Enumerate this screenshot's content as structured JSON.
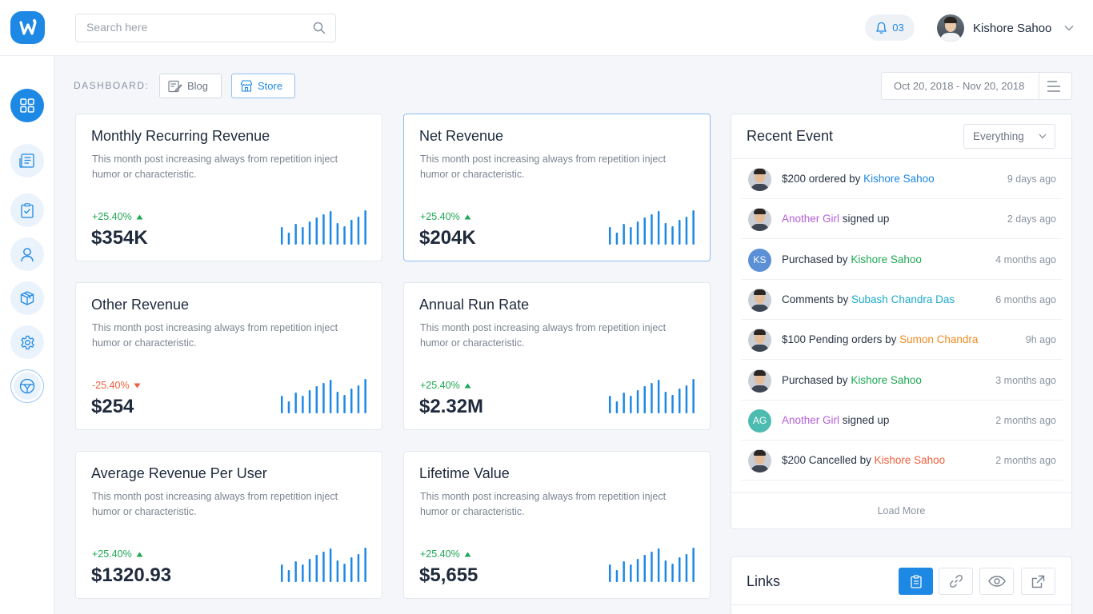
{
  "app": {
    "logo_letter": "w"
  },
  "search": {
    "placeholder": "Search here"
  },
  "notifications": {
    "count": "03"
  },
  "user": {
    "name": "Kishore Sahoo"
  },
  "sidebar": {
    "items": [
      {
        "icon": "grid-icon",
        "active": true
      },
      {
        "icon": "document-list-icon"
      },
      {
        "icon": "clipboard-check-icon"
      },
      {
        "icon": "user-icon"
      },
      {
        "icon": "box-icon"
      },
      {
        "icon": "gear-icon"
      },
      {
        "icon": "compass-icon"
      }
    ]
  },
  "toolbar": {
    "dashboard_label": "DASHBOARD:",
    "blog_label": "Blog",
    "store_label": "Store",
    "date_range": "Oct 20, 2018 - Nov 20, 2018"
  },
  "colors": {
    "accent": "#1e88e5",
    "up": "#1fa855",
    "down": "#f0603c"
  },
  "cards": [
    {
      "title": "Monthly Recurring Revenue",
      "desc": "This month post increasing always from repetition inject humor or characteristic.",
      "change": "+25.40%",
      "direction": "up",
      "value": "$354K"
    },
    {
      "title": "Net Revenue",
      "desc": "This month post increasing always from repetition inject humor or characteristic.",
      "change": "+25.40%",
      "direction": "up",
      "value": "$204K"
    },
    {
      "title": "Other Revenue",
      "desc": "This month post increasing always from repetition inject humor or characteristic.",
      "change": "-25.40%",
      "direction": "down",
      "value": "$254"
    },
    {
      "title": "Annual Run Rate",
      "desc": "This month post increasing always from repetition inject humor or characteristic.",
      "change": "+25.40%",
      "direction": "up",
      "value": "$2.32M"
    },
    {
      "title": "Average Revenue Per User",
      "desc": "This month post increasing always from repetition inject humor or characteristic.",
      "change": "+25.40%",
      "direction": "up",
      "value": "$1320.93"
    },
    {
      "title": "Lifetime Value",
      "desc": "This month post increasing always from repetition inject humor or characteristic.",
      "change": "+25.40%",
      "direction": "up",
      "value": "$5,655"
    }
  ],
  "sparkline": {
    "values": [
      21,
      15,
      25,
      21,
      28,
      33,
      37,
      41,
      26,
      22,
      30,
      34,
      42
    ]
  },
  "recent": {
    "title": "Recent Event",
    "filter": "Everything",
    "load_more": "Load More",
    "events": [
      {
        "pre": "$200 ordered by ",
        "who": "Kishore Sahoo",
        "who_color": "#1e88e5",
        "post": "",
        "time": "9 days ago",
        "avatar": "photo"
      },
      {
        "pre": "",
        "who": "Another Girl",
        "who_color": "#b45ed6",
        "post": " signed up",
        "time": "2 days ago",
        "avatar": "photo"
      },
      {
        "pre": "Purchased by ",
        "who": "Kishore Sahoo",
        "who_color": "#1fa855",
        "post": "",
        "time": "4 months ago",
        "avatar": "KS",
        "avatar_color": "#5b8fd6"
      },
      {
        "pre": "Comments by ",
        "who": "Subash Chandra Das",
        "who_color": "#1eaacb",
        "post": "",
        "time": "6 months ago",
        "avatar": "photo"
      },
      {
        "pre": "$100 Pending orders by ",
        "who": "Sumon Chandra",
        "who_color": "#ef8b22",
        "post": "",
        "time": "9h ago",
        "avatar": "photo"
      },
      {
        "pre": "Purchased by ",
        "who": "Kishore Sahoo",
        "who_color": "#1fa855",
        "post": "",
        "time": "3 months ago",
        "avatar": "photo"
      },
      {
        "pre": "",
        "who": "Another Girl",
        "who_color": "#b45ed6",
        "post": " signed up",
        "time": "2 months ago",
        "avatar": "AG",
        "avatar_color": "#4dbcb0"
      },
      {
        "pre": "$200 Cancelled by ",
        "who": "Kishore Sahoo",
        "who_color": "#f0603c",
        "post": "",
        "time": "2 months ago",
        "avatar": "photo"
      }
    ]
  },
  "links": {
    "title": "Links",
    "buttons": [
      {
        "icon": "clipboard-icon",
        "active": true
      },
      {
        "icon": "link-icon"
      },
      {
        "icon": "eye-icon"
      },
      {
        "icon": "external-link-icon"
      }
    ]
  }
}
